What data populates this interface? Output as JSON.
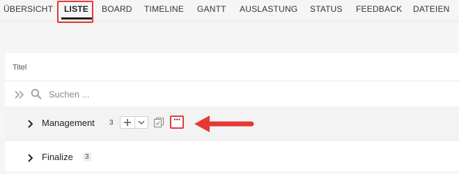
{
  "tabs": [
    {
      "label": "ÜBERSICHT"
    },
    {
      "label": "LISTE",
      "active": true
    },
    {
      "label": "BOARD"
    },
    {
      "label": "TIMELINE"
    },
    {
      "label": "GANTT"
    },
    {
      "label": "AUSLASTUNG"
    },
    {
      "label": "STATUS"
    },
    {
      "label": "FEEDBACK"
    },
    {
      "label": "DATEIEN"
    }
  ],
  "list": {
    "column_title": "Titel",
    "search": {
      "placeholder": "Suchen ...",
      "value": ""
    },
    "groups": [
      {
        "name": "Management",
        "count": "3",
        "hovered": true
      },
      {
        "name": "Finalize",
        "count": "3"
      }
    ]
  },
  "icons": {
    "expand_all": "double-chevron-right-icon",
    "search": "search-icon",
    "expand": "chevron-right-icon",
    "add": "plus-icon",
    "dropdown": "chevron-down-icon",
    "copy": "copy-icon",
    "more": "ellipsis-icon"
  },
  "colors": {
    "highlight": "#e53935",
    "background": "#f5f5f5"
  }
}
